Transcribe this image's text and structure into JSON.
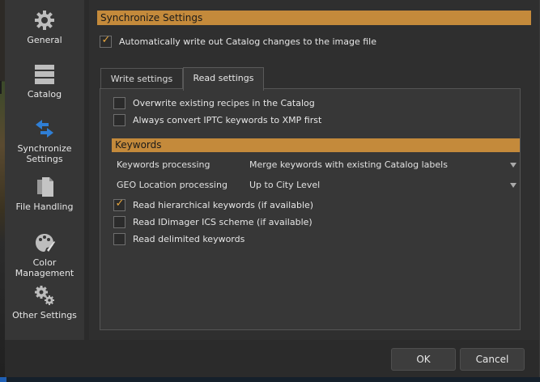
{
  "sidebar": {
    "items": [
      {
        "label": "General",
        "icon": "gear-icon"
      },
      {
        "label": "Catalog",
        "icon": "stack-icon"
      },
      {
        "label": "Synchronize Settings",
        "icon": "sync-arrows-icon"
      },
      {
        "label": "File Handling",
        "icon": "documents-icon"
      },
      {
        "label": "Color Management",
        "icon": "palette-icon"
      },
      {
        "label": "Other Settings",
        "icon": "gears-icon"
      }
    ]
  },
  "sync": {
    "title": "Synchronize Settings",
    "auto_write": {
      "label": "Automatically write out Catalog changes to the image file",
      "checked": true
    }
  },
  "tabs": [
    {
      "label": "Write settings",
      "active": false
    },
    {
      "label": "Read settings",
      "active": true
    }
  ],
  "read": {
    "overwrite": {
      "label": "Overwrite existing recipes in the Catalog",
      "checked": false
    },
    "convert_iptc": {
      "label": "Always convert IPTC keywords to XMP first",
      "checked": false
    },
    "keywords_title": "Keywords",
    "keywords_processing": {
      "label": "Keywords processing",
      "value": "Merge keywords with existing Catalog labels"
    },
    "geo_processing": {
      "label": "GEO Location processing",
      "value": "Up to City Level"
    },
    "hierarchical": {
      "label": "Read hierarchical keywords (if available)",
      "checked": true
    },
    "idimager": {
      "label": "Read IDimager ICS scheme (if available)",
      "checked": false
    },
    "delimited": {
      "label": "Read delimited keywords",
      "checked": false
    }
  },
  "buttons": {
    "ok": "OK",
    "cancel": "Cancel"
  },
  "colors": {
    "accent": "#c48a3b",
    "check": "#e7a63d"
  }
}
